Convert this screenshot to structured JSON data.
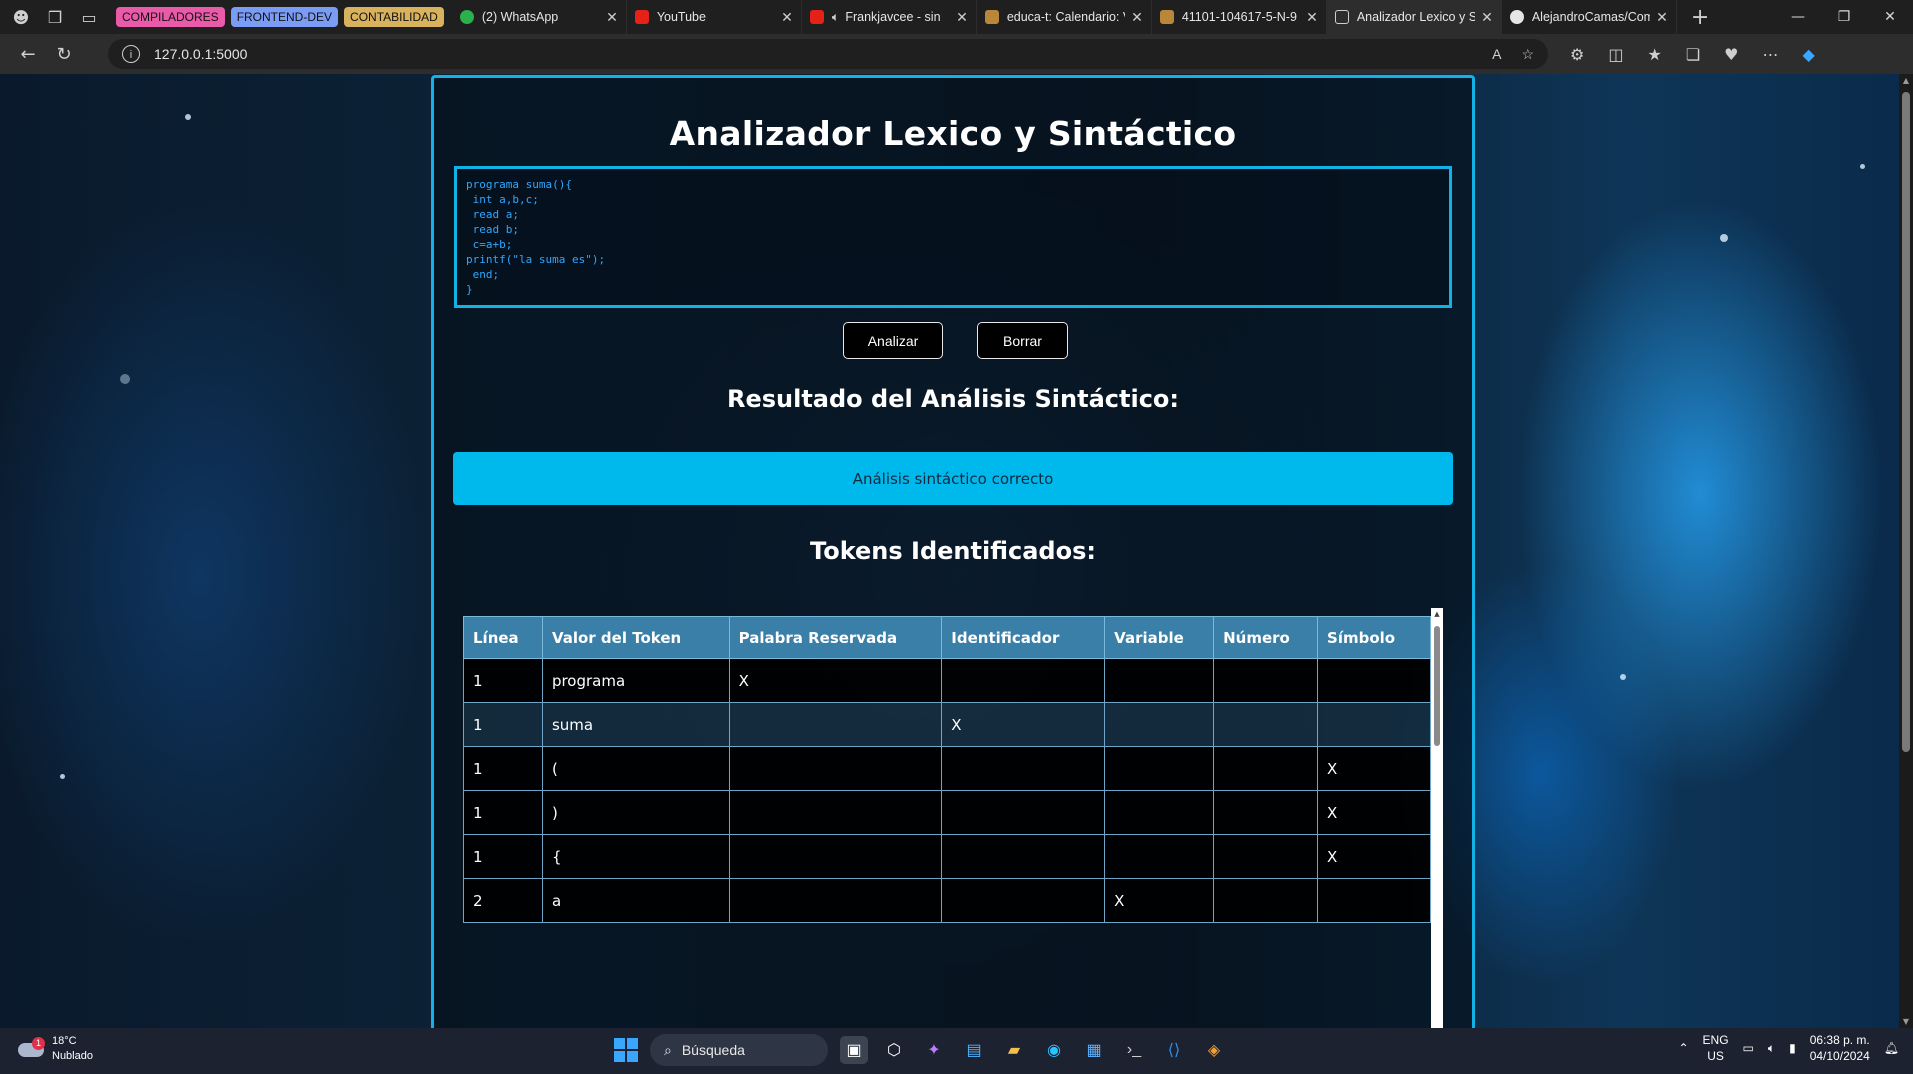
{
  "browser": {
    "tab_groups": [
      {
        "label": "COMPILADORES",
        "color": "#e95aa9"
      },
      {
        "label": "FRONTEND-DEV",
        "color": "#7b9cf5"
      },
      {
        "label": "CONTABILIDAD",
        "color": "#d9b25e"
      }
    ],
    "tabs": [
      {
        "label": "(2) WhatsApp",
        "icon": "whatsapp-icon"
      },
      {
        "label": "YouTube",
        "icon": "youtube-icon"
      },
      {
        "label": "Frankjavcee - sin",
        "icon": "youtube-icon"
      },
      {
        "label": "educa-t: Calendario: V",
        "icon": "educa-icon"
      },
      {
        "label": "41101-104617-5-N-9",
        "icon": "educa-icon"
      },
      {
        "label": "Analizador Lexico y Si",
        "icon": "page-icon",
        "active": true
      },
      {
        "label": "AlejandroCamas/Com",
        "icon": "github-icon"
      }
    ],
    "url": "127.0.0.1:5000"
  },
  "app": {
    "title": "Analizador Lexico y Sintáctico",
    "code": "programa suma(){\n int a,b,c;\n read a;\n read b;\n c=a+b;\nprintf(\"la suma es\");\n end;\n}",
    "analyze_label": "Analizar",
    "clear_label": "Borrar",
    "syntax_heading": "Resultado del Análisis Sintáctico:",
    "syntax_result": "Análisis sintáctico correcto",
    "tokens_heading": "Tokens Identificados:",
    "colors": {
      "accent": "#12b2e6",
      "result_bg": "#00b9ec",
      "header_bg": "#3a7fa8"
    },
    "table": {
      "headers": [
        "Línea",
        "Valor del Token",
        "Palabra Reservada",
        "Identificador",
        "Variable",
        "Número",
        "Símbolo"
      ],
      "rows": [
        [
          "1",
          "programa",
          "X",
          "",
          "",
          "",
          ""
        ],
        [
          "1",
          "suma",
          "",
          "X",
          "",
          "",
          ""
        ],
        [
          "1",
          "(",
          "",
          "",
          "",
          "",
          "X"
        ],
        [
          "1",
          ")",
          "",
          "",
          "",
          "",
          "X"
        ],
        [
          "1",
          "{",
          "",
          "",
          "",
          "",
          "X"
        ],
        [
          "2",
          "a",
          "",
          "",
          "X",
          "",
          ""
        ]
      ]
    }
  },
  "taskbar": {
    "weather_temp": "18°C",
    "weather_desc": "Nublado",
    "weather_badge": "1",
    "search_label": "Búsqueda",
    "lang_top": "ENG",
    "lang_bottom": "US",
    "time": "06:38 p. m.",
    "date": "04/10/2024"
  }
}
